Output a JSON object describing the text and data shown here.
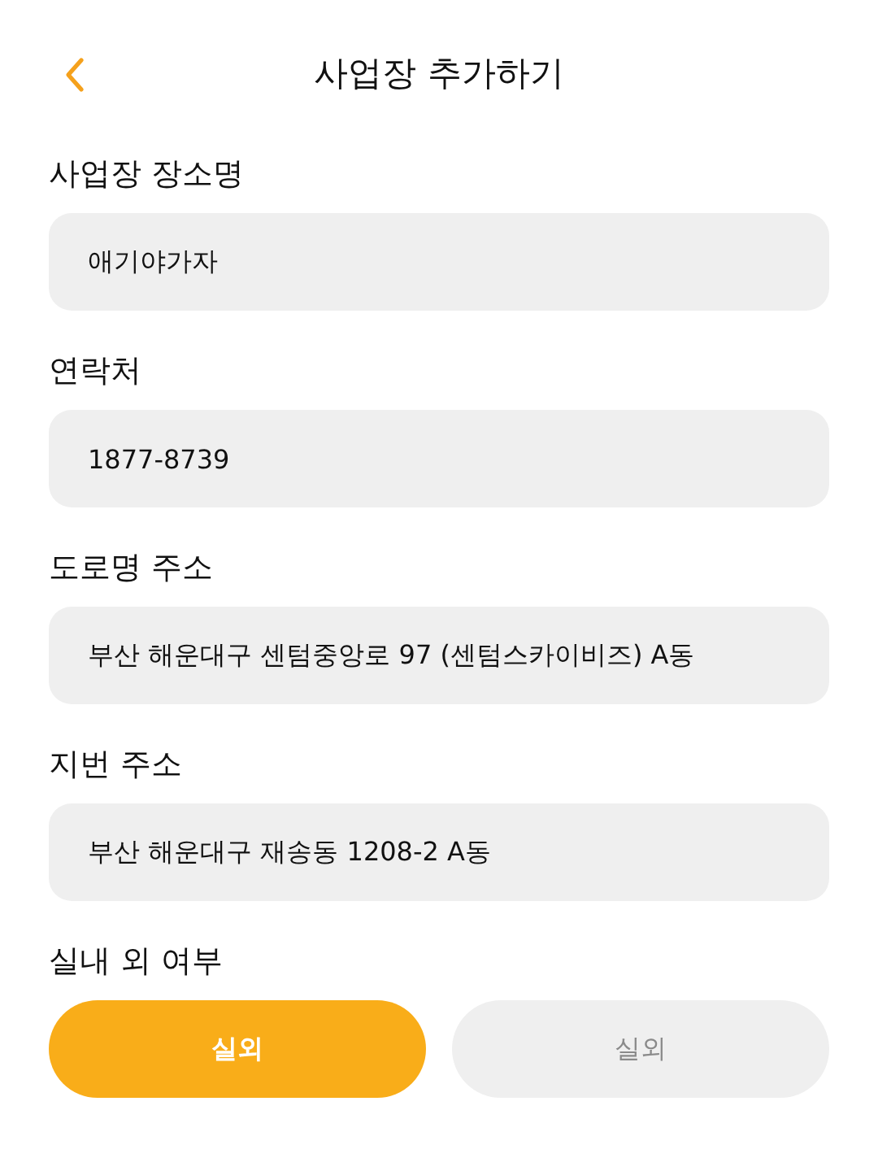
{
  "header": {
    "title": "사업장 추가하기"
  },
  "fields": [
    {
      "label": "사업장 장소명",
      "value": "애기야가자"
    },
    {
      "label": "연락처",
      "value": "1877-8739"
    },
    {
      "label": "도로명 주소",
      "value": "부산 해운대구 센텀중앙로 97 (센텀스카이비즈) A동"
    },
    {
      "label": "지번 주소",
      "value": "부산 해운대구 재송동 1208-2 A동"
    }
  ],
  "indoor_outdoor": {
    "label": "실내 외 여부",
    "options": [
      {
        "label": "실외",
        "selected": true
      },
      {
        "label": "실외",
        "selected": false
      }
    ]
  }
}
